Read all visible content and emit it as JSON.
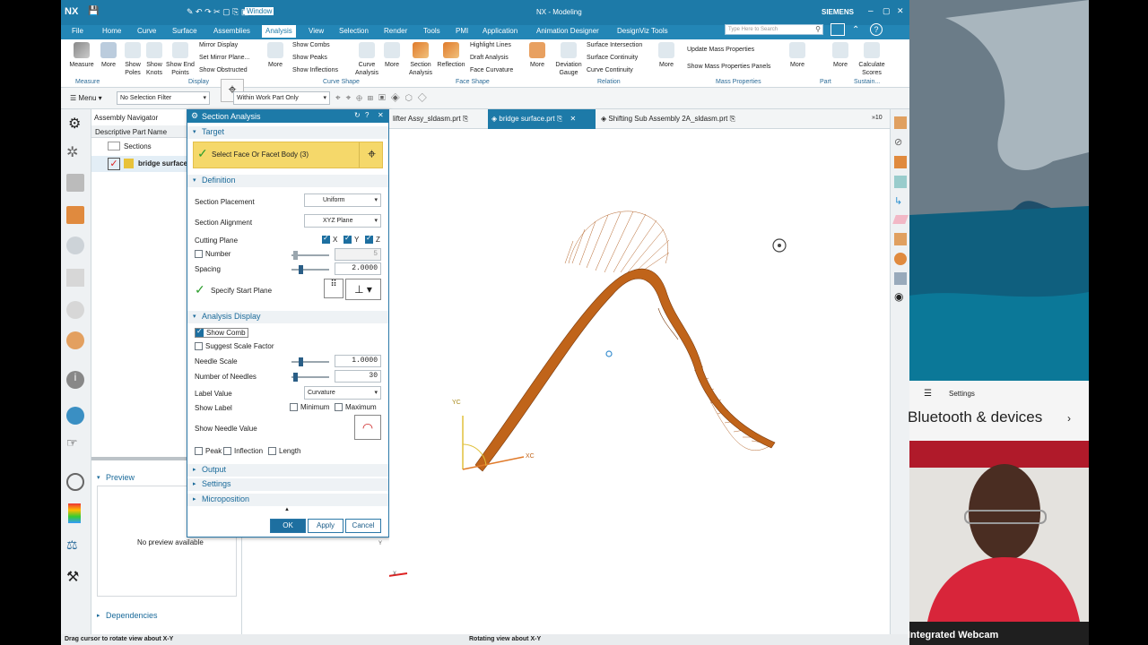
{
  "titlebar": {
    "logo": "NX",
    "window_menu": "Window",
    "title": "NX - Modeling",
    "brand": "SIEMENS"
  },
  "menubar": {
    "items": [
      "File",
      "Home",
      "Curve",
      "Surface",
      "Assemblies",
      "Analysis",
      "View",
      "Selection",
      "Render",
      "Tools",
      "PMI",
      "Application",
      "Animation Designer",
      "DesignViz Tools"
    ],
    "active": "Analysis",
    "search_placeholder": "Type Here to Search"
  },
  "ribbon": {
    "measure": "Measure",
    "more": "More",
    "show_poles": "Show Poles",
    "show_knots": "Show Knots",
    "show_end_points": "Show End Points",
    "mirror_display": "Mirror Display",
    "set_mirror_plane": "Set Mirror Plane...",
    "show_obstructed": "Show Obstructed",
    "show_combs": "Show Combs",
    "show_peaks": "Show Peaks",
    "show_inflections": "Show Inflections",
    "curve_analysis": "Curve Analysis",
    "section_analysis": "Section Analysis",
    "reflection": "Reflection",
    "highlight_lines": "Highlight Lines",
    "draft_analysis": "Draft Analysis",
    "face_curvature": "Face Curvature",
    "deviation_gauge": "Deviation Gauge",
    "surface_intersection": "Surface Intersection",
    "surface_continuity": "Surface Continuity",
    "curve_continuity": "Curve Continuity",
    "update_mass": "Update Mass Properties",
    "show_mass_panels": "Show Mass Properties Panels",
    "calculate_scores": "Calculate Scores",
    "groups": [
      "Measure",
      "Display",
      "Curve Shape",
      "Face Shape",
      "Relation",
      "Mass Properties",
      "Part",
      "Sustain..."
    ]
  },
  "filterbar": {
    "menu": "Menu",
    "selection_filter": "No Selection Filter",
    "scope": "Within Work Part Only"
  },
  "navigator": {
    "title": "Assembly Navigator",
    "column": "Descriptive Part Name",
    "tree": [
      {
        "label": "Sections"
      },
      {
        "label": "bridge surface"
      }
    ],
    "preview_title": "Preview",
    "no_preview": "No preview available",
    "dependencies": "Dependencies"
  },
  "dialog": {
    "title": "Section Analysis",
    "target_section": "Target",
    "select_face": "Select Face Or Facet Body (3)",
    "definition_section": "Definition",
    "section_placement_label": "Section Placement",
    "section_placement_value": "Uniform",
    "section_alignment_label": "Section Alignment",
    "section_alignment_value": "XYZ Plane",
    "cutting_plane_label": "Cutting Plane",
    "cut_x": "X",
    "cut_y": "Y",
    "cut_z": "Z",
    "number_label": "Number",
    "number_value": "5",
    "spacing_label": "Spacing",
    "spacing_value": "2.0000",
    "start_plane_label": "Specify Start Plane",
    "analysis_display_section": "Analysis Display",
    "show_comb": "Show Comb",
    "suggest_scale": "Suggest Scale Factor",
    "needle_scale_label": "Needle Scale",
    "needle_scale_value": "1.0000",
    "num_needles_label": "Number of Needles",
    "num_needles_value": "30",
    "label_value_label": "Label Value",
    "label_value_value": "Curvature",
    "show_label_label": "Show Label",
    "minimum": "Minimum",
    "maximum": "Maximum",
    "show_needle_value": "Show Needle Value",
    "peak": "Peak",
    "inflection": "Inflection",
    "length": "Length",
    "output_section": "Output",
    "settings_section": "Settings",
    "microposition_section": "Microposition",
    "ok": "OK",
    "apply": "Apply",
    "cancel": "Cancel"
  },
  "tabs": [
    {
      "label": "lifter Assy_sldasm.prt",
      "active": false
    },
    {
      "label": "bridge surface.prt",
      "active": true
    },
    {
      "label": "Shifting Sub Assembly 2A_sldasm.prt",
      "active": false
    }
  ],
  "tab_overflow": "»10",
  "viewport": {
    "axis_yc": "YC",
    "axis_xc": "XC",
    "triad_y": "Y",
    "triad_x": "X"
  },
  "statusbar": {
    "left": "Drag cursor to rotate view about X-Y",
    "center": "Rotating view about X-Y"
  },
  "settings_window": {
    "title": "Settings",
    "heading": "Bluetooth & devices"
  },
  "webcam": {
    "label": "Integrated Webcam"
  },
  "colors": {
    "nx_blue": "#1d7aa8",
    "surface_orange": "#c0641a",
    "highlight_yellow": "#f5d86a"
  }
}
